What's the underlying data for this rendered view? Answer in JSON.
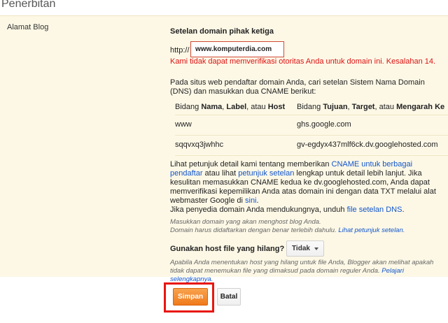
{
  "header": {
    "title": "Penerbitan"
  },
  "form": {
    "field_label": "Alamat Blog",
    "section_title": "Setelan domain pihak ketiga",
    "http_prefix": "http://",
    "domain_value": "www.komputerdia.com",
    "error_message": "Kami tidak dapat memverifikasi otoritas Anda untuk domain ini. Kesalahan 14.",
    "instructions": "Pada situs web pendaftar domain Anda, cari setelan Sistem Nama Domain (DNS) dan masukkan dua CNAME berikut:",
    "table": {
      "header": {
        "col1": {
          "prefix": "Bidang ",
          "b1": "Nama",
          "sep1": ", ",
          "b2": "Label",
          "sep2": ", atau ",
          "b3": "Host"
        },
        "col2": {
          "prefix": "Bidang ",
          "b1": "Tujuan",
          "sep1": ", ",
          "b2": "Target",
          "sep2": ", atau ",
          "b3": "Mengarah Ke"
        }
      },
      "rows": [
        {
          "name": "www",
          "target": "ghs.google.com"
        },
        {
          "name": "sqqvxq3jwhhc",
          "target": "gv-egdyx437mlf6ck.dv.googlehosted.com"
        }
      ]
    },
    "help": {
      "t1": "Lihat petunjuk detail kami tentang memberikan ",
      "link1": "CNAME untuk berbagai pendaftar",
      "t2": " atau lihat ",
      "link2": "petunjuk setelan",
      "t3": " lengkap untuk detail lebih lanjut. Jika kesulitan memasukkan CNAME kedua ke dv.googlehosted.com, Anda dapat memverifikasi kepemilikan Anda atas domain ini dengan data TXT melalui alat webmaster Google di ",
      "link3": "sini",
      "t4": ".",
      "t5": "Jika penyedia domain Anda mendukungnya, unduh ",
      "link4": "file setelan DNS",
      "t6": "."
    },
    "hint1": {
      "line1": "Masukkan domain yang akan menghost blog Anda.",
      "line2": "Domain harus didaftarkan dengan benar terlebih dahulu. ",
      "link": "Lihat petunjuk setelan",
      "end": "."
    },
    "missing_files": {
      "label": "Gunakan host file yang hilang?",
      "selected": "Tidak"
    },
    "hint2": {
      "text": "Apabila Anda menentukan host yang hilang untuk file Anda, Blogger akan melihat apakah tidak dapat menemukan file yang dimaksud pada domain reguler Anda.",
      "link": "Pelajari selengkapnya",
      "end": "."
    }
  },
  "actions": {
    "save": "Simpan",
    "cancel": "Batal"
  },
  "colors": {
    "accent_orange": "#f07a1a",
    "highlight_red": "#e8160f",
    "error_red": "#dd1111",
    "link_blue": "#1155cc",
    "panel_bg": "#fdf8e6"
  }
}
